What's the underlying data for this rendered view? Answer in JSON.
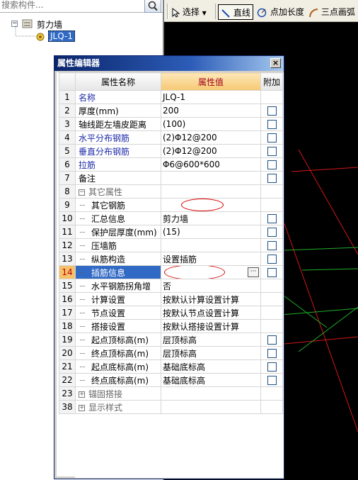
{
  "search": {
    "placeholder": "搜索构件..."
  },
  "tree": {
    "root_label": "剪力墙",
    "root_expander": "−",
    "child_label": "JLQ-1"
  },
  "toolbar": {
    "select_label": "选择",
    "line_label": "直线",
    "point_length_label": "点加长度",
    "three_point_arc_label": "三点画弧"
  },
  "dialog": {
    "title": "属性编辑器",
    "close_glyph": "×",
    "columns": {
      "name": "属性名称",
      "value": "属性值",
      "extra": "附加"
    },
    "dots": "···",
    "rows": [
      {
        "num": "1",
        "name": "名称",
        "value": "JLQ-1",
        "style": "blue",
        "check": false
      },
      {
        "num": "2",
        "name": "厚度(mm)",
        "value": "200",
        "style": "normal",
        "check": true
      },
      {
        "num": "3",
        "name": "轴线距左墙皮距离",
        "value": "(100)",
        "style": "normal",
        "check": true
      },
      {
        "num": "4",
        "name": "水平分布钢筋",
        "value": "(2)Φ12@200",
        "style": "blue",
        "check": true
      },
      {
        "num": "5",
        "name": "垂直分布钢筋",
        "value": "(2)Φ12@200",
        "style": "blue",
        "check": true
      },
      {
        "num": "6",
        "name": "拉筋",
        "value": "Φ6@600*600",
        "style": "blue",
        "check": true
      },
      {
        "num": "7",
        "name": "备注",
        "value": "",
        "style": "normal",
        "check": true
      },
      {
        "num": "8",
        "name": "其它属性",
        "value": "",
        "style": "group-open",
        "check": false
      },
      {
        "num": "9",
        "name": "其它钢筋",
        "value": "",
        "style": "sub",
        "check": false
      },
      {
        "num": "10",
        "name": "汇总信息",
        "value": "剪力墙",
        "style": "sub",
        "check": true
      },
      {
        "num": "11",
        "name": "保护层厚度(mm)",
        "value": "(15)",
        "style": "sub",
        "check": true
      },
      {
        "num": "12",
        "name": "压墙筋",
        "value": "",
        "style": "sub",
        "check": true
      },
      {
        "num": "13",
        "name": "纵筋构造",
        "value": "设置插筋",
        "style": "sub",
        "check": true
      },
      {
        "num": "14",
        "name": "插筋信息",
        "value": "",
        "style": "sub-selected",
        "check": true
      },
      {
        "num": "15",
        "name": "水平钢筋拐角增",
        "value": "否",
        "style": "sub",
        "check": false
      },
      {
        "num": "16",
        "name": "计算设置",
        "value": "按默认计算设置计算",
        "style": "sub",
        "check": false
      },
      {
        "num": "17",
        "name": "节点设置",
        "value": "按默认节点设置计算",
        "style": "sub",
        "check": false
      },
      {
        "num": "18",
        "name": "搭接设置",
        "value": "按默认搭接设置计算",
        "style": "sub",
        "check": false
      },
      {
        "num": "19",
        "name": "起点顶标高(m)",
        "value": "层顶标高",
        "style": "sub",
        "check": true
      },
      {
        "num": "20",
        "name": "终点顶标高(m)",
        "value": "层顶标高",
        "style": "sub",
        "check": true
      },
      {
        "num": "21",
        "name": "起点底标高(m)",
        "value": "基础底标高",
        "style": "sub",
        "check": true
      },
      {
        "num": "22",
        "name": "终点底标高(m)",
        "value": "基础底标高",
        "style": "sub",
        "check": true
      },
      {
        "num": "23",
        "name": "锚固搭接",
        "value": "",
        "style": "group-closed",
        "check": false
      },
      {
        "num": "38",
        "name": "显示样式",
        "value": "",
        "style": "group-closed",
        "check": false
      }
    ]
  }
}
